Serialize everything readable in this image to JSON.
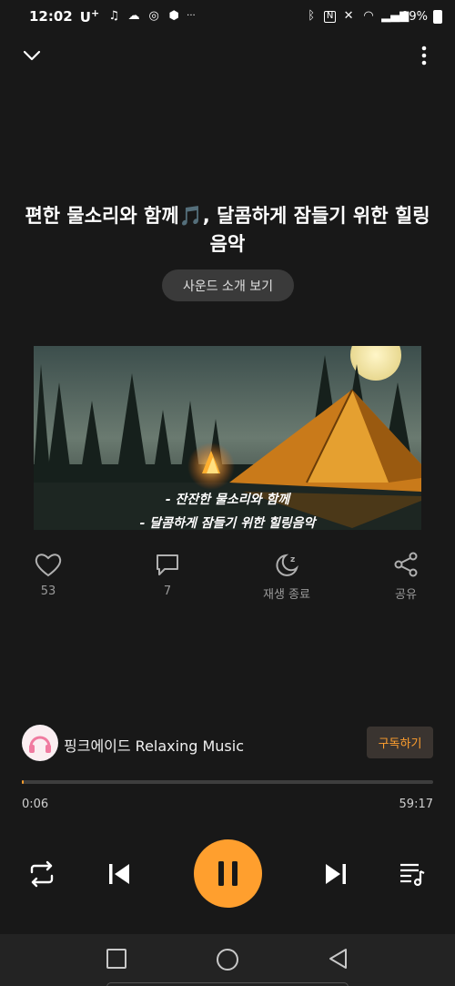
{
  "status_bar": {
    "time": "12:02",
    "carrier": "U",
    "carrier_plus": "+",
    "dots": "···",
    "battery": "99%"
  },
  "track": {
    "title": "편한 물소리와 함께🎵, 달콤하게 잠들기 위한 힐링음악",
    "sound_intro_label": "사운드 소개 보기"
  },
  "cover": {
    "caption_line1": "- 잔잔한 물소리와 함께",
    "caption_line2": "- 달콤하게 잠들기 위한 힐링음악"
  },
  "actions": {
    "like_count": "53",
    "comment_count": "7",
    "sleep_timer_label": "재생 종료",
    "share_label": "공유"
  },
  "channel": {
    "name": "핑크에이드 Relaxing Music",
    "subscribe_label": "구독하기"
  },
  "player": {
    "current_time": "0:06",
    "total_time": "59:17",
    "progress": 0.0017
  },
  "icons": {
    "collapse": "chevron-down-icon",
    "more": "more-vertical-icon",
    "like": "heart-icon",
    "comment": "comment-icon",
    "sleep": "moon-timer-icon",
    "share": "share-icon",
    "repeat": "repeat-icon",
    "prev": "skip-previous-icon",
    "pause": "pause-icon",
    "next": "skip-next-icon",
    "playlist": "playlist-icon"
  },
  "colors": {
    "background": "#181818",
    "accent": "#ff9f2e",
    "button_bg": "#3a3a3a",
    "muted_text": "#9a9a9a"
  }
}
